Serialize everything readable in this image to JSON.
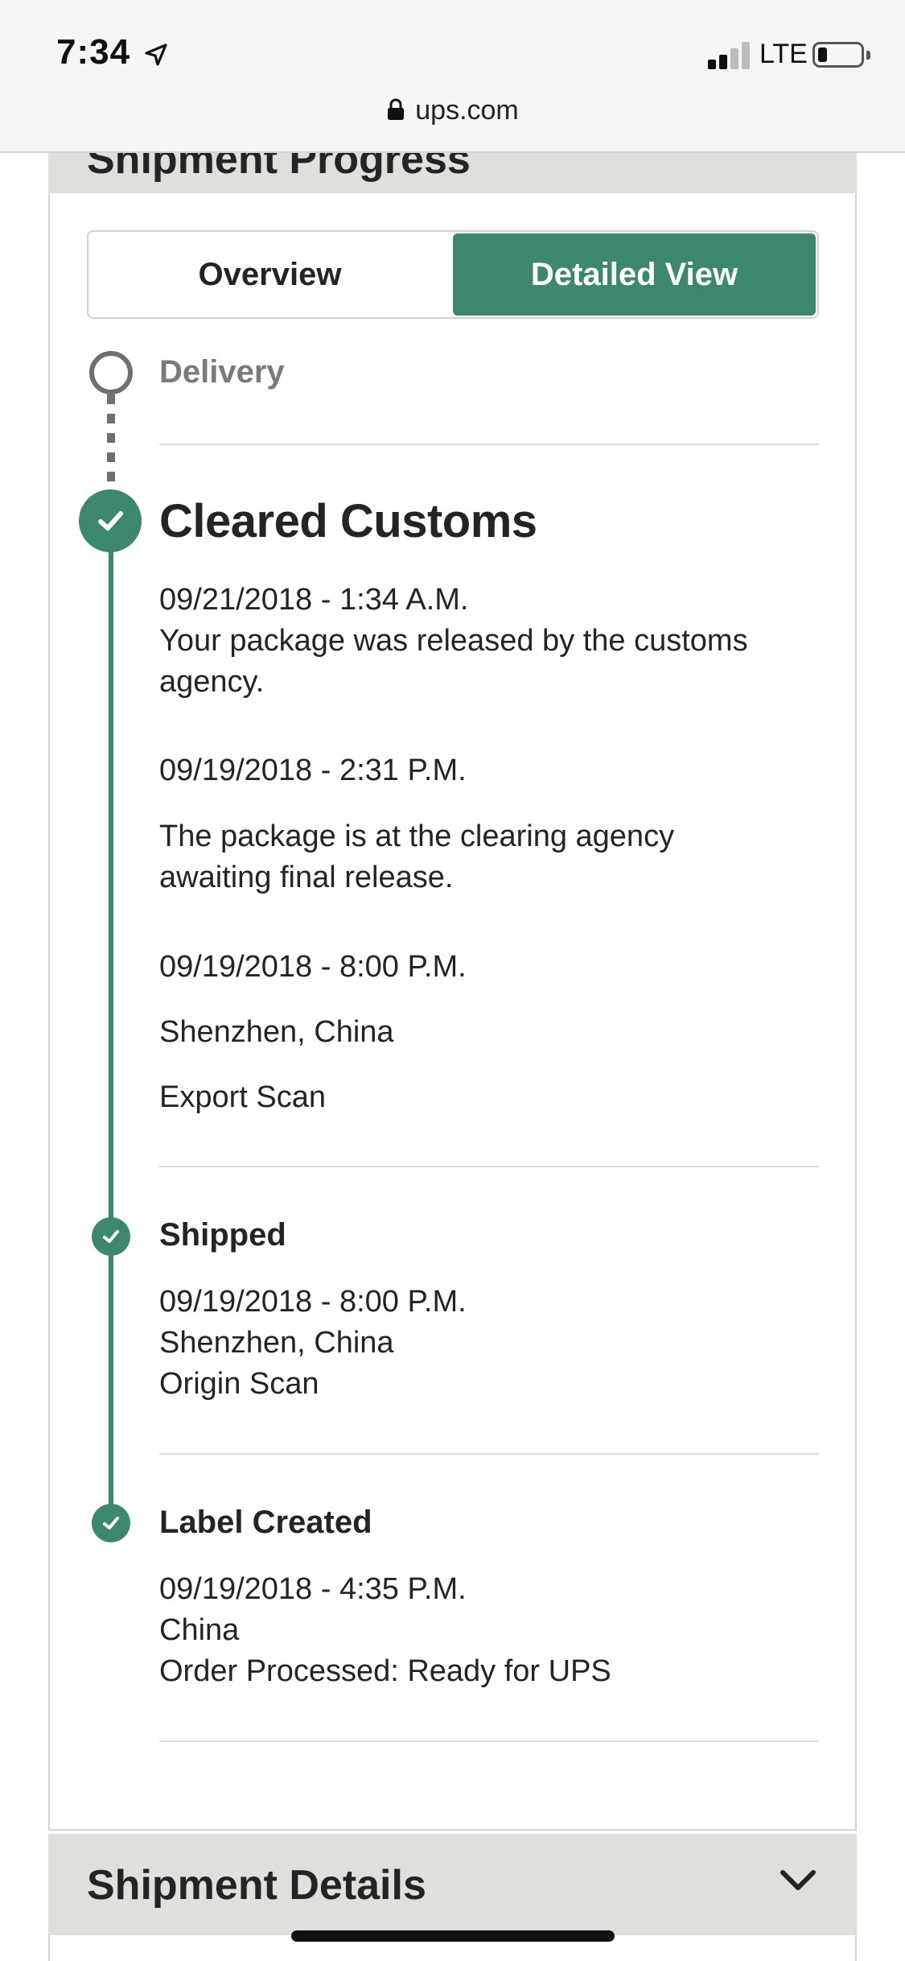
{
  "status_bar": {
    "time": "7:34",
    "network": "LTE",
    "signal_bars_active": 2,
    "signal_bars_total": 4,
    "battery_level": 0.18
  },
  "browser": {
    "url": "ups.com"
  },
  "panel": {
    "title": "Shipment Progress",
    "tabs": [
      {
        "label": "Overview",
        "active": false
      },
      {
        "label": "Detailed View",
        "active": true
      }
    ]
  },
  "timeline": {
    "pending_step": "Delivery",
    "current": {
      "title": "Cleared Customs",
      "events": [
        {
          "datetime": "09/21/2018 - 1:34 A.M.",
          "lines": [
            "Your package was released by the customs",
            "agency."
          ]
        },
        {
          "datetime": "09/19/2018 - 2:31 P.M.",
          "lines": [
            "The package is at the clearing agency",
            "awaiting final release."
          ]
        },
        {
          "datetime": "09/19/2018 - 8:00 P.M.",
          "location": "Shenzhen, China",
          "activity": "Export Scan"
        }
      ]
    },
    "steps": [
      {
        "title": "Shipped",
        "datetime": "09/19/2018 - 8:00 P.M.",
        "location": "Shenzhen, China",
        "activity": "Origin Scan"
      },
      {
        "title": "Label Created",
        "datetime": "09/19/2018 - 4:35 P.M.",
        "location": "China",
        "activity": "Order Processed: Ready for UPS"
      }
    ]
  },
  "shipment_details": {
    "title": "Shipment Details"
  },
  "colors": {
    "accent": "#3d8770",
    "panel_header": "#dfdfdb",
    "muted": "#6f6f6f"
  },
  "icons": {
    "location": "location-arrow-icon",
    "lock": "lock-icon",
    "check": "check-icon",
    "chevron": "chevron-down-icon"
  }
}
